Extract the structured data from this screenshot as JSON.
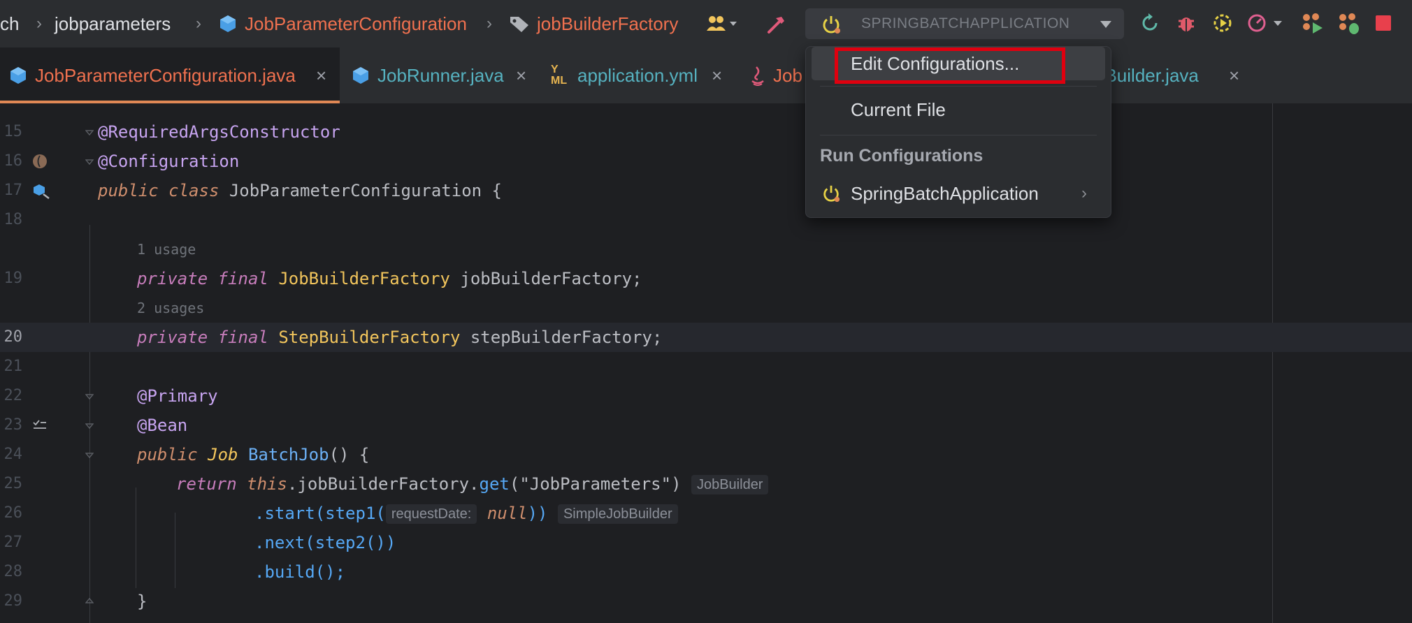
{
  "breadcrumb": {
    "items": [
      "ch",
      "jobparameters",
      "JobParameterConfiguration",
      "jobBuilderFactory"
    ]
  },
  "toolbar": {
    "run_configuration": "SPRINGBATCHAPPLICATION",
    "icons": [
      "users-icon",
      "hammer-icon",
      "power-icon",
      "rerun-icon",
      "debug-icon",
      "coverage-icon",
      "profiler-icon",
      "run-android-icon",
      "debug-android-icon",
      "stop-icon"
    ]
  },
  "tabs": [
    {
      "label": "JobParameterConfiguration.java",
      "active": true
    },
    {
      "label": "JobRunner.java",
      "active": false
    },
    {
      "label": "application.yml",
      "active": false
    },
    {
      "label": "Job",
      "active": false
    },
    {
      "label": "bBuilder.java",
      "active": false
    }
  ],
  "popup": {
    "edit_configurations": "Edit Configurations...",
    "current_file": "Current File",
    "section_header": "Run Configurations",
    "run_config_item": "SpringBatchApplication"
  },
  "editor": {
    "line_numbers": [
      "15",
      "16",
      "17",
      "18",
      "19",
      "20",
      "21",
      "22",
      "23",
      "24",
      "25",
      "26",
      "27",
      "28",
      "29"
    ],
    "usage_hints": [
      "1 usage",
      "2 usages"
    ],
    "lines": {
      "l15": "@RequiredArgsConstructor",
      "l16": "@Configuration",
      "l17_kw1": "public",
      "l17_kw2": "class",
      "l17_name": "JobParameterConfiguration",
      "l17_brace": "{",
      "l19_kw1": "private",
      "l19_kw2": "final",
      "l19_type": "JobBuilderFactory",
      "l19_name": "jobBuilderFactory;",
      "l20_kw1": "private",
      "l20_kw2": "final",
      "l20_type": "StepBuilderFactory",
      "l20_name": "stepBuilderFactory;",
      "l22": "@Primary",
      "l23": "@Bean",
      "l24_kw": "public",
      "l24_type": "Job",
      "l24_name": "BatchJob",
      "l24_rest": "() {",
      "l25_kw": "return",
      "l25_this": "this",
      "l25_field": ".jobBuilderFactory.",
      "l25_method": "get",
      "l25_open": "(",
      "l25_str": "\"JobParameters\"",
      "l25_close": ")",
      "l25_hint": "JobBuilder",
      "l26_method": ".start(step1(",
      "l26_param": "requestDate:",
      "l26_null": "null",
      "l26_close": "))",
      "l26_hint": "SimpleJobBuilder",
      "l27": ".next(step2())",
      "l28": ".build();",
      "l29": "}"
    }
  }
}
